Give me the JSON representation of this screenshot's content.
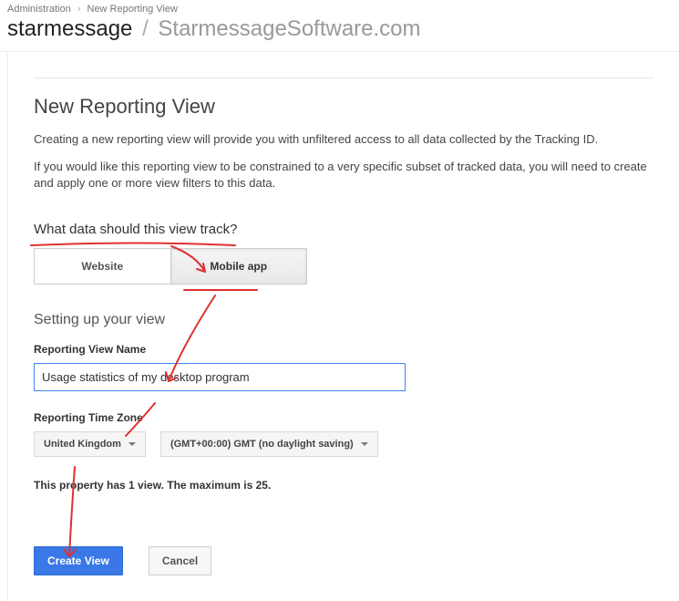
{
  "breadcrumb": {
    "root": "Administration",
    "current": "New Reporting View"
  },
  "title": {
    "main": "starmessage",
    "sub": "StarmessageSoftware.com"
  },
  "page": {
    "heading": "New Reporting View",
    "intro1": "Creating a new reporting view will provide you with unfiltered access to all data collected by the Tracking ID.",
    "intro2": "If you would like this reporting view to be constrained to a very specific subset of tracked data, you will need to create and apply one or more view filters to this data."
  },
  "track": {
    "question": "What data should this view track?",
    "option_website": "Website",
    "option_mobile": "Mobile app",
    "selected": "Mobile app"
  },
  "setup": {
    "heading": "Setting up your view",
    "name_label": "Reporting View Name",
    "name_value": "Usage statistics of my desktop program",
    "tz_label": "Reporting Time Zone",
    "tz_country": "United Kingdom",
    "tz_offset": "(GMT+00:00) GMT (no daylight saving)"
  },
  "note": "This property has 1 view. The maximum is 25.",
  "buttons": {
    "create": "Create View",
    "cancel": "Cancel"
  }
}
